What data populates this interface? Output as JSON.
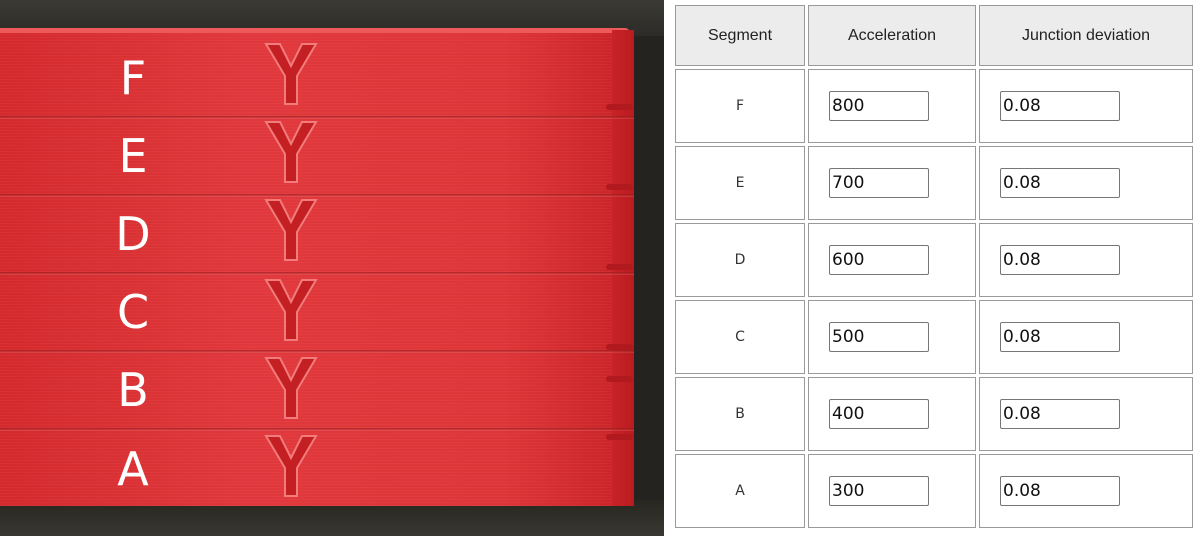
{
  "photo": {
    "segment_labels": [
      "F",
      "E",
      "D",
      "C",
      "B",
      "A"
    ]
  },
  "table": {
    "headers": [
      "Segment",
      "Acceleration",
      "Junction deviation"
    ],
    "rows": [
      {
        "segment": "F",
        "acceleration": "800",
        "junction_deviation": "0.08"
      },
      {
        "segment": "E",
        "acceleration": "700",
        "junction_deviation": "0.08"
      },
      {
        "segment": "D",
        "acceleration": "600",
        "junction_deviation": "0.08"
      },
      {
        "segment": "C",
        "acceleration": "500",
        "junction_deviation": "0.08"
      },
      {
        "segment": "B",
        "acceleration": "400",
        "junction_deviation": "0.08"
      },
      {
        "segment": "A",
        "acceleration": "300",
        "junction_deviation": "0.08"
      }
    ]
  },
  "colors": {
    "print_red": "#de3538",
    "header_bg": "#ececec",
    "border": "#9a9a9a"
  }
}
